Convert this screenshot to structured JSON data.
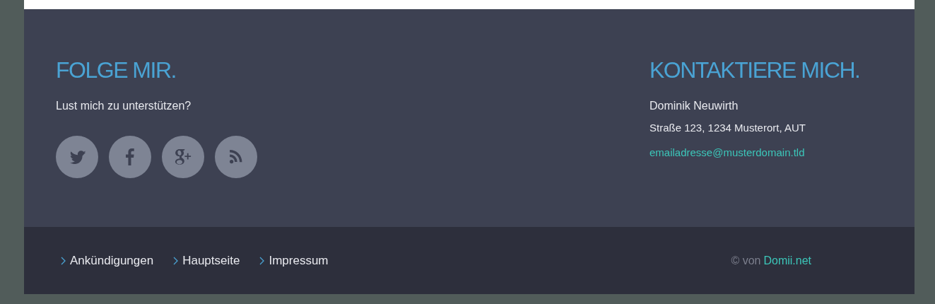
{
  "follow": {
    "heading": "FOLGE MIR.",
    "text": "Lust mich zu unterstützen?",
    "social": [
      {
        "kind": "twitter"
      },
      {
        "kind": "facebook"
      },
      {
        "kind": "googleplus"
      },
      {
        "kind": "rss"
      }
    ]
  },
  "contact": {
    "heading": "KONTAKTIERE MICH.",
    "name": "Dominik Neuwirth",
    "address": "Straße 123, 1234 Musterort, AUT",
    "email": "emailadresse@musterdomain.tld"
  },
  "footer_nav": [
    "Ankündigungen",
    "Hauptseite",
    "Impressum"
  ],
  "copyright": {
    "text": "© von",
    "link": "Domii.net"
  }
}
